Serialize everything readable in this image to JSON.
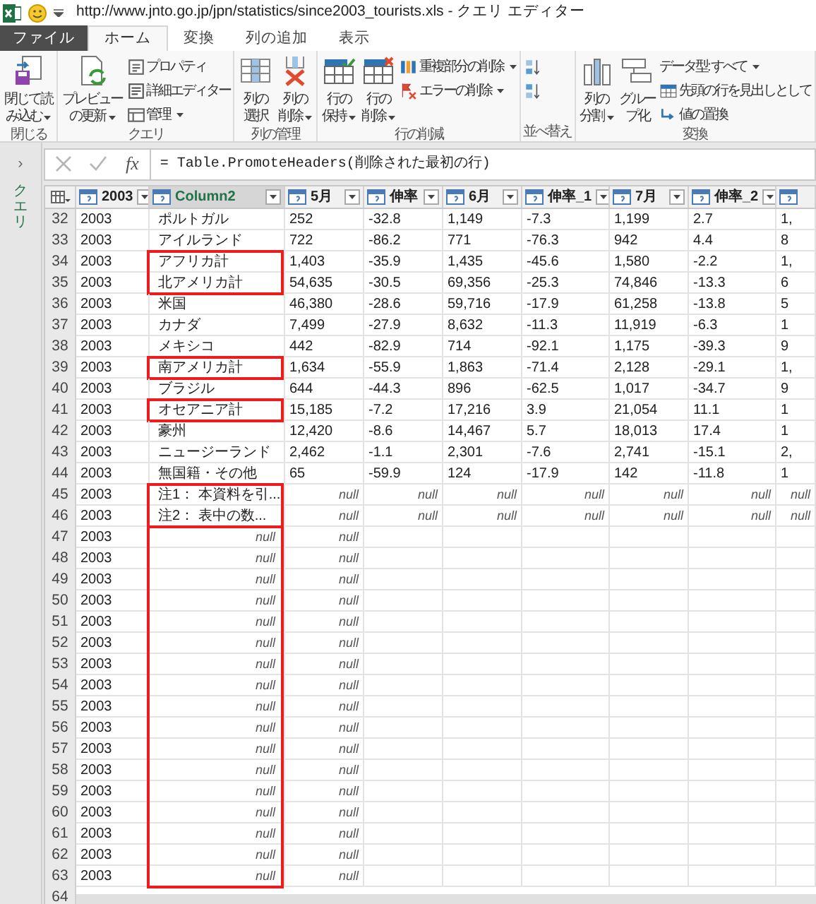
{
  "title_bar": {
    "title": "http://www.jnto.go.jp/jpn/statistics/since2003_tourists.xls - クエリ エディター"
  },
  "tabs": [
    {
      "label": "ファイル",
      "kind": "file",
      "selected": false
    },
    {
      "label": "ホーム",
      "kind": "tab",
      "selected": true
    },
    {
      "label": "変換",
      "kind": "tab",
      "selected": false
    },
    {
      "label": "列の追加",
      "kind": "tab",
      "selected": false
    },
    {
      "label": "表示",
      "kind": "tab",
      "selected": false
    }
  ],
  "ribbon": {
    "groups": [
      {
        "label": "閉じる",
        "items": [
          {
            "kind": "large",
            "lines": [
              "閉じて読",
              "み込む"
            ],
            "dropdown": true
          }
        ]
      },
      {
        "label": "クエリ",
        "items": [
          {
            "kind": "large",
            "lines": [
              "プレビュー",
              "の更新"
            ],
            "dropdown": true
          },
          {
            "kind": "small",
            "label": "プロパティ",
            "dropdown": false
          },
          {
            "kind": "small",
            "label": "詳細エディター",
            "dropdown": false
          },
          {
            "kind": "small",
            "label": "管理",
            "dropdown": true
          }
        ]
      },
      {
        "label": "列の管理",
        "items": [
          {
            "kind": "large",
            "lines": [
              "列の",
              "選択"
            ],
            "dropdown": false
          },
          {
            "kind": "large",
            "lines": [
              "列の",
              "削除"
            ],
            "dropdown": true
          }
        ]
      },
      {
        "label": "行の削減",
        "items": [
          {
            "kind": "large",
            "lines": [
              "行の",
              "保持"
            ],
            "dropdown": true
          },
          {
            "kind": "large",
            "lines": [
              "行の",
              "削除"
            ],
            "dropdown": true
          },
          {
            "kind": "small",
            "label": "重複部分の削除",
            "dropdown": true
          },
          {
            "kind": "small",
            "label": "エラーの削除",
            "dropdown": true
          }
        ]
      },
      {
        "label": "並べ替え",
        "items": [
          {
            "kind": "small"
          },
          {
            "kind": "small"
          }
        ]
      },
      {
        "label": "変換",
        "items": [
          {
            "kind": "large",
            "lines": [
              "列の",
              "分割"
            ],
            "dropdown": true
          },
          {
            "kind": "large",
            "lines": [
              "グルー",
              "プ化"
            ],
            "dropdown": false
          },
          {
            "kind": "small",
            "label": "データ型: すべて",
            "dropdown": true
          },
          {
            "kind": "small",
            "label": "先頭の行を見出しとして",
            "dropdown": false
          },
          {
            "kind": "small",
            "label": "値の置換",
            "dropdown": false
          }
        ]
      }
    ]
  },
  "sidebar": {
    "label": "クエリ",
    "toggle": "›"
  },
  "formula_bar": {
    "fx": "fx",
    "formula": "= Table.PromoteHeaders(削除された最初の行)"
  },
  "table": {
    "columns": [
      {
        "name": "2003",
        "selected": false
      },
      {
        "name": "Column2",
        "selected": true
      },
      {
        "name": "5月",
        "selected": false
      },
      {
        "name": "伸率",
        "selected": false
      },
      {
        "name": "6月",
        "selected": false
      },
      {
        "name": "伸率_1",
        "selected": false
      },
      {
        "name": "7月",
        "selected": false
      },
      {
        "name": "伸率_2",
        "selected": false
      },
      {
        "selected": false
      }
    ],
    "row_groups": [
      {
        "boxed": false,
        "rows": [
          {
            "number": "32",
            "values": [
              "2003",
              "ポルトガル",
              "252",
              "-32.8",
              "1,149",
              "-7.3",
              "1,199",
              "2.7",
              "1,"
            ]
          },
          {
            "number": "33",
            "values": [
              "2003",
              "アイルランド",
              "722",
              "-86.2",
              "771",
              "-76.3",
              "942",
              "4.4",
              "8"
            ]
          }
        ]
      },
      {
        "boxed": true,
        "rows": [
          {
            "number": "34",
            "values": [
              "2003",
              "アフリカ計",
              "1,403",
              "-35.9",
              "1,435",
              "-45.6",
              "1,580",
              "-2.2",
              "1,"
            ]
          },
          {
            "number": "35",
            "values": [
              "2003",
              "北アメリカ計",
              "54,635",
              "-30.5",
              "69,356",
              "-25.3",
              "74,846",
              "-13.3",
              "6"
            ]
          }
        ]
      },
      {
        "boxed": false,
        "rows": [
          {
            "number": "36",
            "values": [
              "2003",
              "米国",
              "46,380",
              "-28.6",
              "59,716",
              "-17.9",
              "61,258",
              "-13.8",
              "5"
            ]
          },
          {
            "number": "37",
            "values": [
              "2003",
              "カナダ",
              "7,499",
              "-27.9",
              "8,632",
              "-11.3",
              "11,919",
              "-6.3",
              "1"
            ]
          },
          {
            "number": "38",
            "values": [
              "2003",
              "メキシコ",
              "442",
              "-82.9",
              "714",
              "-92.1",
              "1,175",
              "-39.3",
              "9"
            ]
          }
        ]
      },
      {
        "boxed": true,
        "rows": [
          {
            "number": "39",
            "values": [
              "2003",
              "南アメリカ計",
              "1,634",
              "-55.9",
              "1,863",
              "-71.4",
              "2,128",
              "-29.1",
              "1,"
            ]
          }
        ]
      },
      {
        "boxed": false,
        "rows": [
          {
            "number": "40",
            "values": [
              "2003",
              "ブラジル",
              "644",
              "-44.3",
              "896",
              "-62.5",
              "1,017",
              "-34.7",
              "9"
            ]
          }
        ]
      },
      {
        "boxed": true,
        "rows": [
          {
            "number": "41",
            "values": [
              "2003",
              "オセアニア計",
              "15,185",
              "-7.2",
              "17,216",
              "3.9",
              "21,054",
              "11.1",
              "1"
            ]
          }
        ]
      },
      {
        "boxed": false,
        "rows": [
          {
            "number": "42",
            "values": [
              "2003",
              "豪州",
              "12,420",
              "-8.6",
              "14,467",
              "5.7",
              "18,013",
              "17.4",
              "1"
            ]
          },
          {
            "number": "43",
            "values": [
              "2003",
              "ニュージーランド",
              "2,462",
              "-1.1",
              "2,301",
              "-7.6",
              "2,741",
              "-15.1",
              "2,"
            ]
          },
          {
            "number": "44",
            "values": [
              "2003",
              "無国籍・その他",
              "65",
              "-59.9",
              "124",
              "-17.9",
              "142",
              "-11.8",
              "1"
            ]
          }
        ]
      },
      {
        "boxed": true,
        "rows": [
          {
            "number": "45",
            "values": [
              "2003",
              "注1： 本資料を引..."
            ],
            "nulls": [
              "null",
              "null",
              "null",
              "null",
              "null",
              "null",
              "null"
            ]
          },
          {
            "number": "46",
            "values": [
              "2003",
              "注2： 表中の数..."
            ],
            "nulls": [
              "null",
              "null",
              "null",
              "null",
              "null",
              "null",
              "null"
            ]
          }
        ]
      },
      {
        "boxed": true,
        "rows": [
          {
            "number": "47",
            "values": [
              "2003"
            ],
            "nulls": [
              "null",
              "null"
            ]
          },
          {
            "number": "48",
            "values": [
              "2003"
            ],
            "nulls": [
              "null",
              "null"
            ]
          },
          {
            "number": "49",
            "values": [
              "2003"
            ],
            "nulls": [
              "null",
              "null"
            ]
          },
          {
            "number": "50",
            "values": [
              "2003"
            ],
            "nulls": [
              "null",
              "null"
            ]
          },
          {
            "number": "51",
            "values": [
              "2003"
            ],
            "nulls": [
              "null",
              "null"
            ]
          },
          {
            "number": "52",
            "values": [
              "2003"
            ],
            "nulls": [
              "null",
              "null"
            ]
          },
          {
            "number": "53",
            "values": [
              "2003"
            ],
            "nulls": [
              "null",
              "null"
            ]
          },
          {
            "number": "54",
            "values": [
              "2003"
            ],
            "nulls": [
              "null",
              "null"
            ]
          },
          {
            "number": "55",
            "values": [
              "2003"
            ],
            "nulls": [
              "null",
              "null"
            ]
          },
          {
            "number": "56",
            "values": [
              "2003"
            ],
            "nulls": [
              "null",
              "null"
            ]
          },
          {
            "number": "57",
            "values": [
              "2003"
            ],
            "nulls": [
              "null",
              "null"
            ]
          },
          {
            "number": "58",
            "values": [
              "2003"
            ],
            "nulls": [
              "null",
              "null"
            ]
          },
          {
            "number": "59",
            "values": [
              "2003"
            ],
            "nulls": [
              "null",
              "null"
            ]
          },
          {
            "number": "60",
            "values": [
              "2003"
            ],
            "nulls": [
              "null",
              "null"
            ]
          },
          {
            "number": "61",
            "values": [
              "2003"
            ],
            "nulls": [
              "null",
              "null"
            ]
          },
          {
            "number": "62",
            "values": [
              "2003"
            ],
            "nulls": [
              "null",
              "null"
            ]
          },
          {
            "number": "63",
            "values": [
              "2003"
            ],
            "nulls": [
              "null",
              "null"
            ]
          }
        ]
      }
    ],
    "partial_row_number": "64"
  }
}
